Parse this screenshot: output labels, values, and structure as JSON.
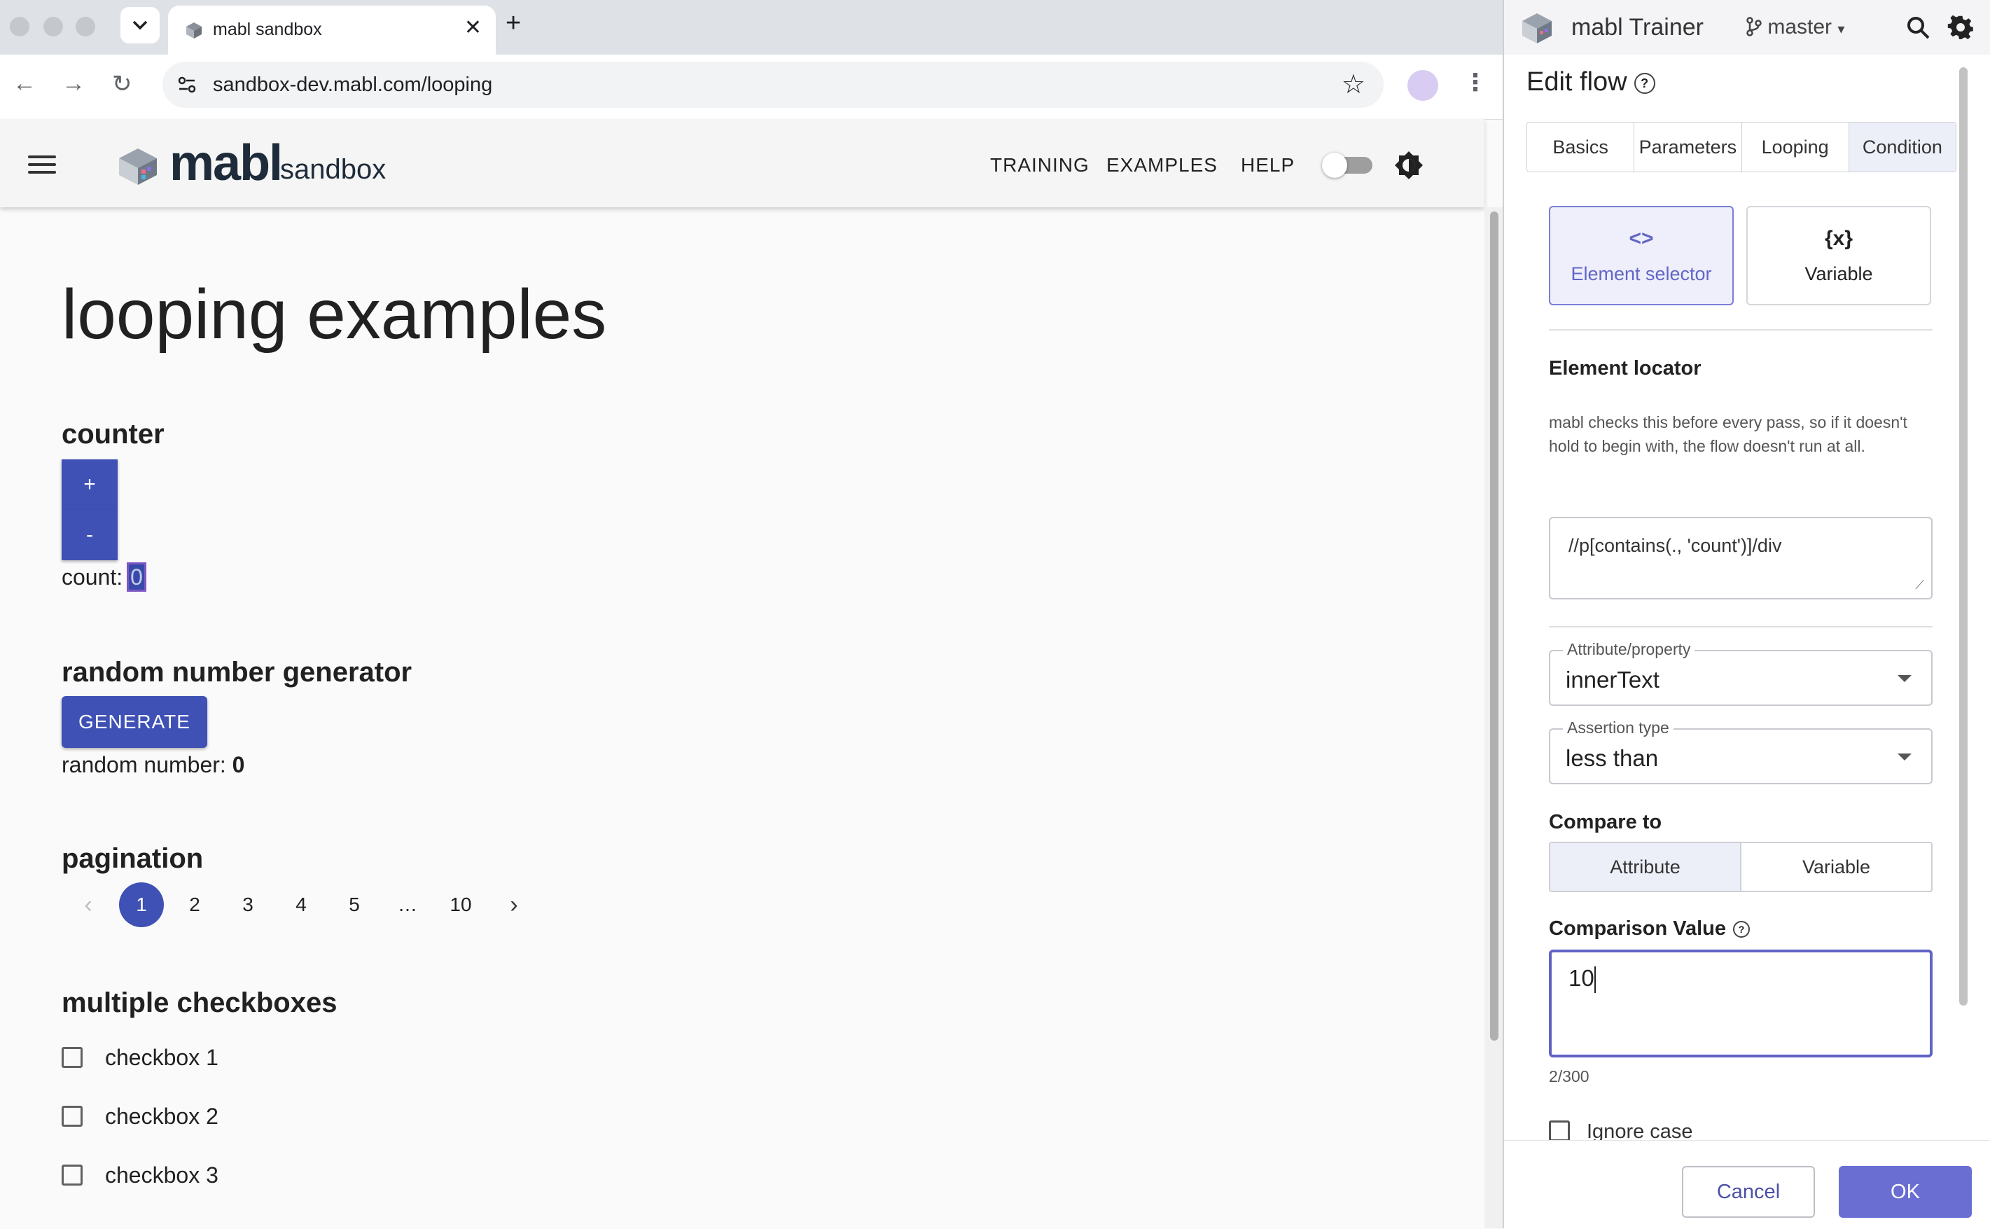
{
  "browser": {
    "tab_title": "mabl sandbox",
    "url": "sandbox-dev.mabl.com/looping"
  },
  "site": {
    "logo_word": "mabl",
    "logo_suffix": "sandbox",
    "nav": [
      "TRAINING",
      "EXAMPLES",
      "HELP"
    ]
  },
  "page": {
    "title": "looping examples",
    "counter": {
      "heading": "counter",
      "plus_label": "+",
      "minus_label": "-",
      "count_label": "count: ",
      "count_value": "0"
    },
    "random": {
      "heading": "random number generator",
      "button_label": "GENERATE",
      "result_label": "random number: ",
      "result_value": "0"
    },
    "pagination": {
      "heading": "pagination",
      "pages": [
        "1",
        "2",
        "3",
        "4",
        "5",
        "…",
        "10"
      ],
      "active": "1"
    },
    "checkboxes": {
      "heading": "multiple checkboxes",
      "items": [
        "checkbox 1",
        "checkbox 2",
        "checkbox 3"
      ]
    }
  },
  "trainer": {
    "title": "mabl Trainer",
    "branch": "master",
    "edit_flow_title": "Edit flow",
    "tabs": [
      "Basics",
      "Parameters",
      "Looping",
      "Condition"
    ],
    "active_tab": "Condition",
    "condition_types": [
      {
        "icon": "<>",
        "label": "Element selector"
      },
      {
        "icon": "{x}",
        "label": "Variable"
      }
    ],
    "element_locator_label": "Element locator",
    "help_text": "mabl checks this before every pass, so if it doesn't hold to begin with, the flow doesn't run at all.",
    "locator_value": "//p[contains(., 'count')]/div",
    "attribute_label": "Attribute/property",
    "attribute_value": "innerText",
    "assertion_label": "Assertion type",
    "assertion_value": "less than",
    "compare_to_label": "Compare to",
    "compare_options": [
      "Attribute",
      "Variable"
    ],
    "comparison_value_label": "Comparison Value",
    "comparison_value": "10",
    "char_counter": "2/300",
    "ignore_case_label": "Ignore case",
    "cancel_label": "Cancel",
    "ok_label": "OK"
  },
  "colors": {
    "primary": "#3f51b5",
    "trainer_accent": "#6a6ed3"
  }
}
